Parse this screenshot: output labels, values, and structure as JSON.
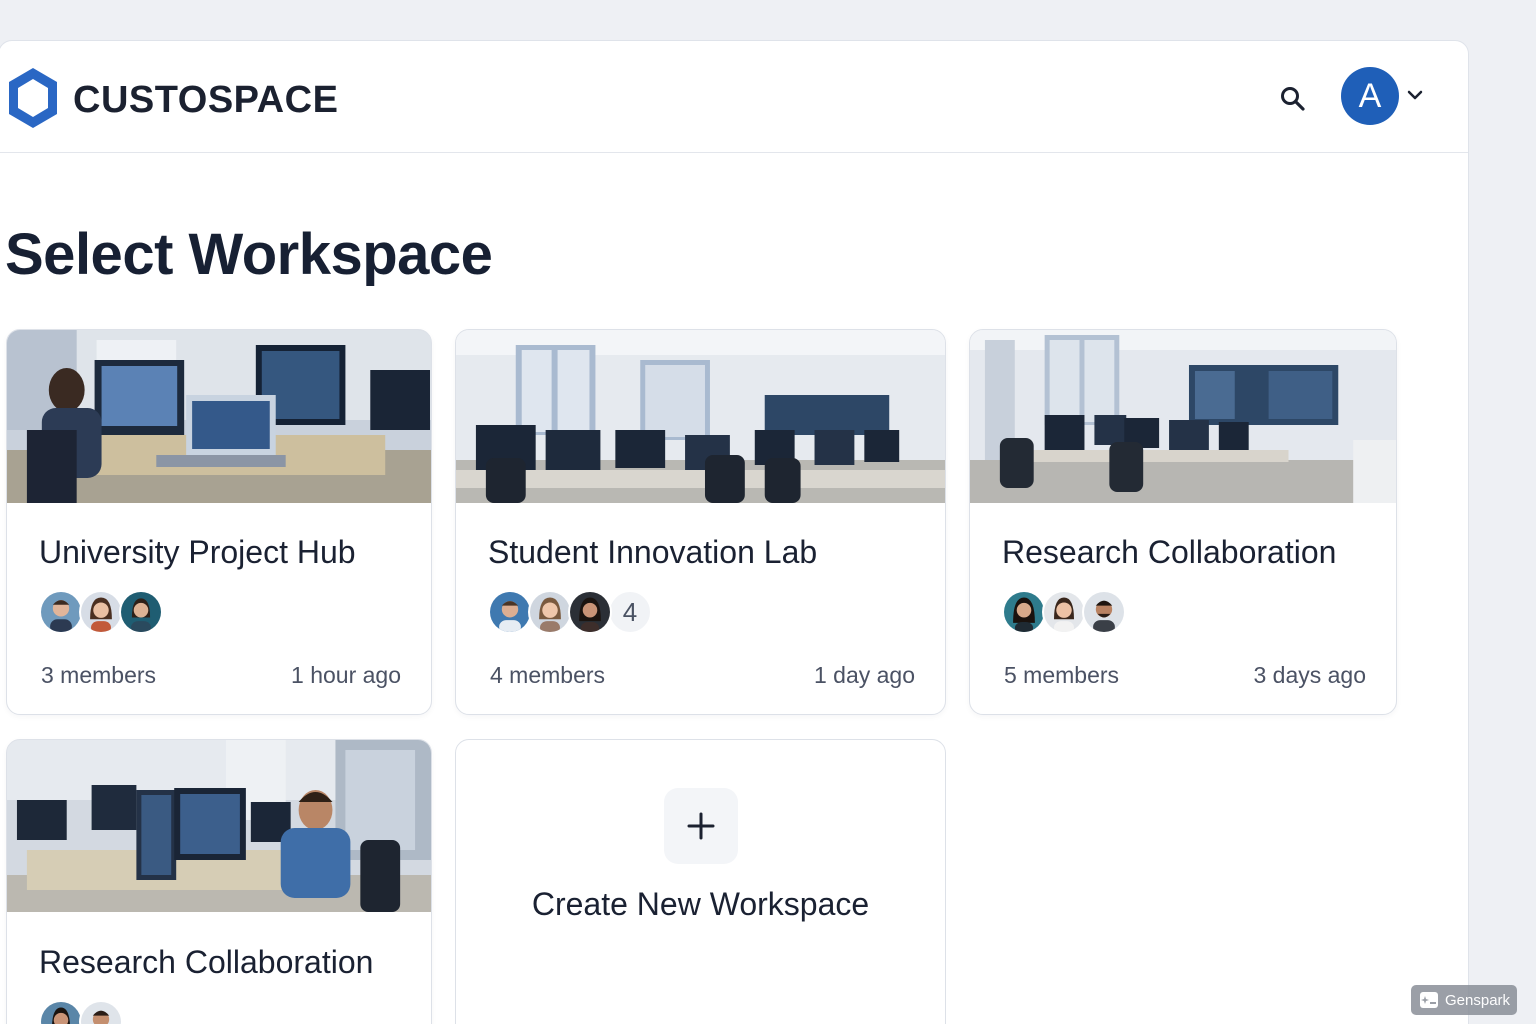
{
  "header": {
    "brand": "CUSTOSPACE",
    "user_initial": "A",
    "logo_color": "#2a67c4",
    "avatar_color": "#1f5fb8"
  },
  "page_title": "Select Workspace",
  "workspaces": [
    {
      "name": "University Project Hub",
      "members": "3 members",
      "updated": "1 hour ago",
      "extra_count": ""
    },
    {
      "name": "Student Innovation Lab",
      "members": "4 members",
      "updated": "1 day ago",
      "extra_count": "4"
    },
    {
      "name": "Research Collaboration",
      "members": "5 members",
      "updated": "3 days ago",
      "extra_count": ""
    },
    {
      "name": "Research Collaboration",
      "members": "",
      "updated": "",
      "extra_count": ""
    }
  ],
  "create": {
    "label": "Create New Workspace"
  },
  "watermark": {
    "label": "Genspark"
  }
}
